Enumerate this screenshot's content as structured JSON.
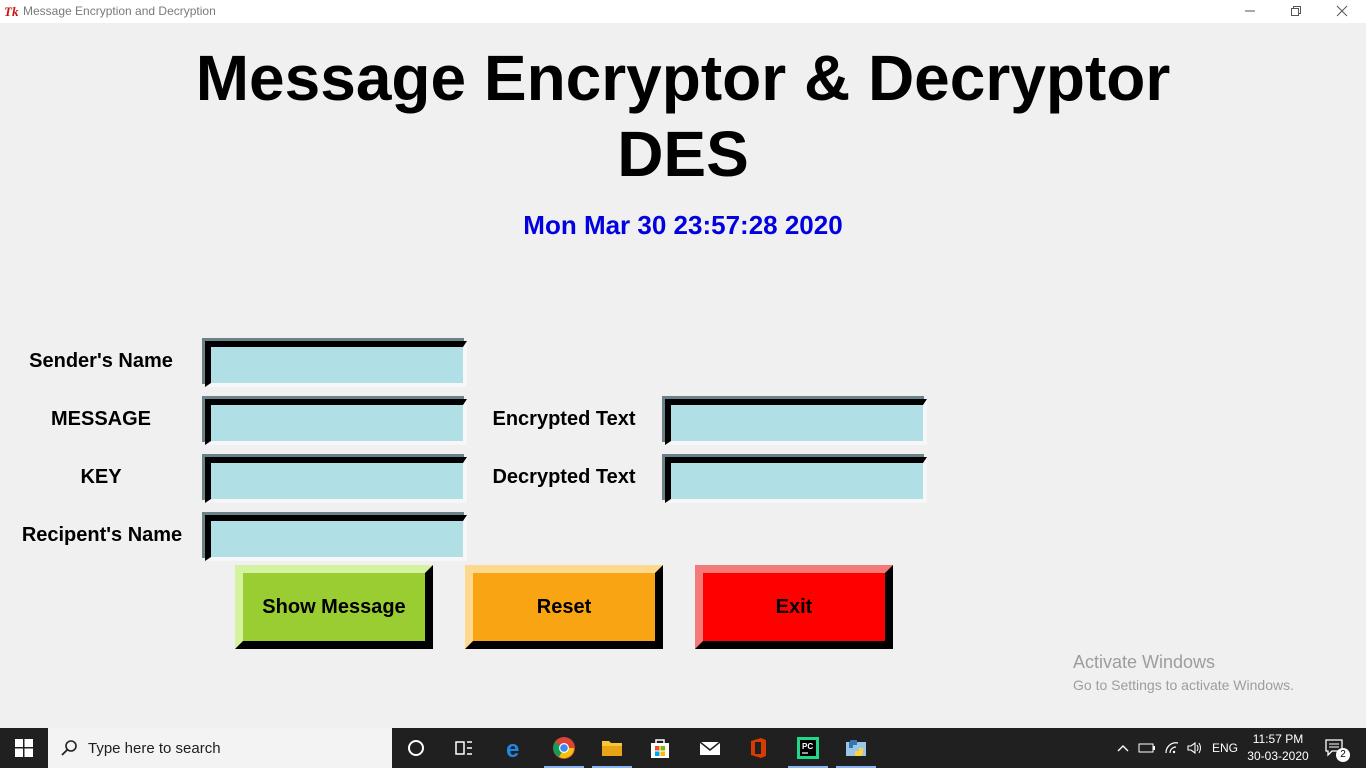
{
  "window": {
    "title": "Message Encryption and Decryption",
    "minimize_icon": "minimize-icon",
    "restore_icon": "restore-icon",
    "close_icon": "close-icon"
  },
  "header": {
    "title_line1": "Message Encryptor & Decryptor",
    "title_line2": "DES",
    "clock": "Mon Mar 30 23:57:28 2020",
    "clock_color": "#0000e0"
  },
  "form": {
    "sender_label": "Sender's Name",
    "message_label": "MESSAGE",
    "key_label": "KEY",
    "recipient_label": "Recipent's Name",
    "encrypted_label": "Encrypted Text",
    "decrypted_label": "Decrypted Text",
    "sender_value": "",
    "message_value": "",
    "key_value": "",
    "recipient_value": "",
    "encrypted_value": "",
    "decrypted_value": "",
    "field_color": "#b0e0e6"
  },
  "buttons": {
    "show": "Show Message",
    "reset": "Reset",
    "exit": "Exit",
    "show_color": "#9acd32",
    "reset_color": "#f9a413",
    "exit_color": "#ff0000"
  },
  "watermark": {
    "line1": "Activate Windows",
    "line2": "Go to Settings to activate Windows."
  },
  "taskbar": {
    "search_placeholder": "Type here to search",
    "language": "ENG",
    "time": "11:57 PM",
    "date": "30-03-2020",
    "notification_count": "2",
    "pinned": [
      "cortana-icon",
      "task-view-icon",
      "edge-icon",
      "chrome-icon",
      "file-explorer-icon",
      "store-icon",
      "mail-icon",
      "office-icon",
      "pycharm-icon",
      "python-icon"
    ]
  }
}
